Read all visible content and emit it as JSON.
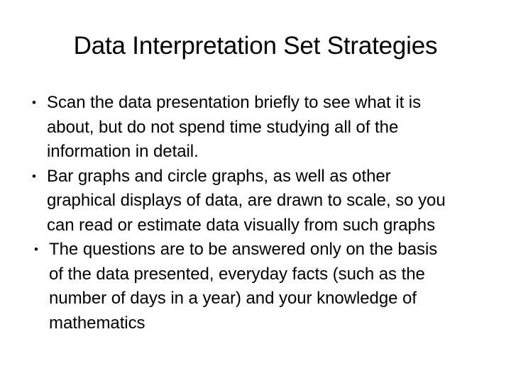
{
  "slide": {
    "title": "Data Interpretation Set Strategies",
    "bullet_marker": "•",
    "background_color": "#ffffff",
    "text_color": "#000000",
    "bullets": [
      {
        "text": "Scan the data presentation briefly to see what it is about, but do not spend time studying all of the information in detail.",
        "lines": [
          "Scan the data presentation briefly to see what it is",
          "about, but do not spend time studying all of the",
          "information in detail."
        ]
      },
      {
        "text": "Bar graphs and circle graphs, as well as other graphical displays of data, are drawn to scale, so you can read or estimate data visually from such graphs",
        "lines": [
          "Bar graphs and circle graphs, as well as other",
          "graphical displays of data, are drawn to scale, so you",
          "can read or estimate data visually from such graphs"
        ]
      },
      {
        "text": "The questions are to be answered only on the basis of the data presented, everyday facts (such as the number of days in a year) and your knowledge of mathematics",
        "lines": [
          "The questions are to be answered only on the basis",
          "of the data presented, everyday facts (such as the",
          "number of days in a year) and your knowledge of",
          "mathematics"
        ]
      }
    ]
  }
}
